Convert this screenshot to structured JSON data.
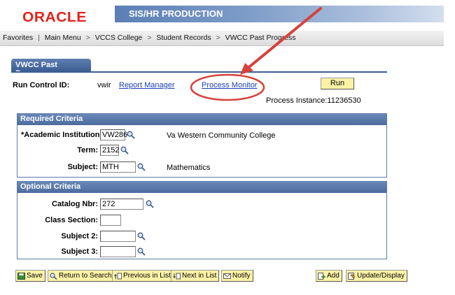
{
  "header": {
    "logo": "ORACLE",
    "banner_title": "SIS/HR PRODUCTION"
  },
  "breadcrumb": [
    "Favorites",
    "Main Menu",
    "VCCS College",
    "Student Records",
    "VWCC Past Progress"
  ],
  "page": {
    "tab_label": "VWCC Past Progress",
    "run_control_label": "Run Control ID:",
    "run_control_value": "vwir",
    "report_manager": "Report Manager",
    "process_monitor": "Process Monitor",
    "run_label": "Run",
    "process_instance": "Process Instance:11236530"
  },
  "required": {
    "title": "Required Criteria",
    "institution_label": "*Academic Institution:",
    "institution_value": "VW286",
    "institution_desc": "Va Western Community College",
    "term_label": "Term:",
    "term_value": "2152",
    "subject_label": "Subject:",
    "subject_value": "MTH",
    "subject_desc": "Mathematics"
  },
  "optional": {
    "title": "Optional Criteria",
    "catalog_label": "Catalog Nbr:",
    "catalog_value": "272",
    "section_label": "Class Section:",
    "section_value": "",
    "subject2_label": "Subject 2:",
    "subject2_value": "",
    "subject3_label": "Subject 3:",
    "subject3_value": ""
  },
  "toolbar": {
    "save": "Save",
    "return_to_search": "Return to Search",
    "previous_in_list": "Previous in List",
    "next_in_list": "Next in List",
    "notify": "Notify",
    "add": "Add",
    "update_display": "Update/Display"
  },
  "colors": {
    "oracle_red": "#e2231a",
    "header_blue": "#4b6b9e",
    "button_yellow": "#fcf2a6",
    "annotation_red": "#d6423a"
  }
}
